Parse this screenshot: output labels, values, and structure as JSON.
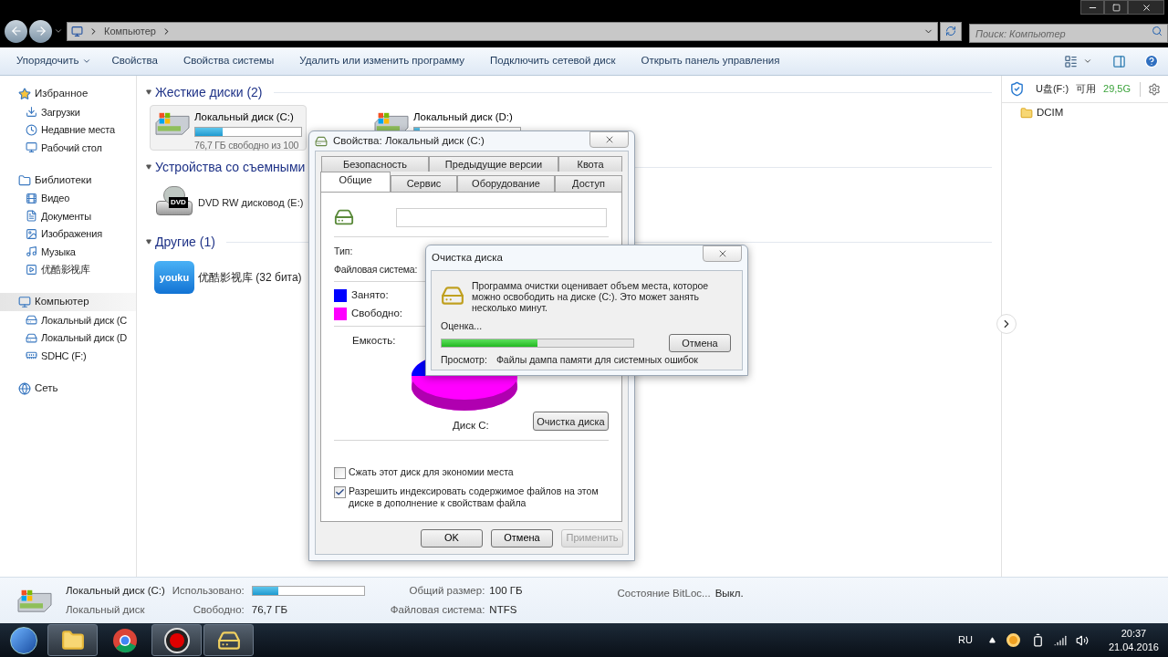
{
  "window": {
    "address": [
      "Компьютер"
    ],
    "search": {
      "placeholder": "Поиск: Компьютер"
    }
  },
  "toolbar": [
    {
      "label": "Упорядочить",
      "kind": "menu"
    },
    {
      "label": "Свойства",
      "kind": "button"
    },
    {
      "label": "Свойства системы",
      "kind": "button"
    },
    {
      "label": "Удалить или изменить программу",
      "kind": "button"
    },
    {
      "label": "Подключить сетевой диск",
      "kind": "button"
    },
    {
      "label": "Открыть панель управления",
      "kind": "button"
    }
  ],
  "sidebar": [
    {
      "label": "Избранное",
      "selected": false,
      "children": [
        {
          "label": "Загрузки",
          "selected": false
        },
        {
          "label": "Недавние места",
          "selected": false
        },
        {
          "label": "Рабочий стол",
          "selected": false
        }
      ]
    },
    {
      "label": "Библиотеки",
      "selected": false,
      "children": [
        {
          "label": "Видео",
          "selected": false
        },
        {
          "label": "Документы",
          "selected": false
        },
        {
          "label": "Изображения",
          "selected": false
        },
        {
          "label": "Музыка",
          "selected": false
        },
        {
          "label": "优酷影视库",
          "selected": false
        }
      ]
    },
    {
      "label": "Компьютер",
      "selected": true,
      "children": [
        {
          "label": "Локальный диск (C",
          "selected": false
        },
        {
          "label": "Локальный диск (D",
          "selected": false
        },
        {
          "label": "SDHC (F:)",
          "selected": false
        }
      ]
    },
    {
      "label": "Сеть",
      "selected": false
    }
  ],
  "groups": [
    {
      "title": "Жесткие диски (2)",
      "items": [
        {
          "kind": "disk",
          "name": "Локальный диск (C:)",
          "level": 0.26,
          "free": "76,7 ГБ свободно из 100",
          "selected": true
        },
        {
          "kind": "disk",
          "name": "Локальный диск (D:)",
          "level": 0.05,
          "selected": false
        }
      ]
    },
    {
      "title": "Устройства со съемными",
      "items": [
        {
          "kind": "dvd",
          "name": "DVD RW дисковод (E:)",
          "logo_text": "DVD",
          "selected": false
        }
      ]
    },
    {
      "title": "Другие (1)",
      "items": [
        {
          "kind": "app",
          "name": "优酷影视库 (32 бита)",
          "logo_text": "youku",
          "selected": false
        }
      ]
    }
  ],
  "right_panel": {
    "drive": "U盘(F:)",
    "available_label": "可用",
    "available": "29,5G",
    "items": [
      "DCIM"
    ]
  },
  "properties_dialog": {
    "title": "Свойства: Локальный диск (C:)",
    "tab_rows": [
      [
        {
          "label": "Безопасность",
          "selected": false
        },
        {
          "label": "Предыдущие версии",
          "selected": false
        },
        {
          "label": "Квота",
          "selected": false
        }
      ],
      [
        {
          "label": "Общие",
          "selected": true
        },
        {
          "label": "Сервис",
          "selected": false
        },
        {
          "label": "Оборудование",
          "selected": false
        },
        {
          "label": "Доступ",
          "selected": false
        }
      ]
    ],
    "type_label": "Тип:",
    "fs_label": "Файловая система:",
    "legend": [
      {
        "label": "Занято:",
        "color": "#0000ff"
      },
      {
        "label": "Свободно:",
        "color": "#ff00ff"
      }
    ],
    "capacity_label": "Емкость:",
    "disk_label": "Диск C:",
    "cleanup_button": "Очистка диска",
    "checkboxes": [
      {
        "label": "Сжать этот диск для экономии места",
        "checked": false
      },
      {
        "label": "Разрешить индексировать содержимое файлов на этом диске в дополнение к свойствам файла",
        "checked": true
      }
    ],
    "buttons": [
      {
        "label": "OK",
        "disabled": false
      },
      {
        "label": "Отмена",
        "disabled": false
      },
      {
        "label": "Применить",
        "disabled": true
      }
    ]
  },
  "cleanup_dialog": {
    "title": "Очистка диска",
    "message": "Программа очистки оценивает объем места, которое можно освободить на диске  (C:). Это может занять несколько минут.",
    "status": "Оценка...",
    "level": 0.5,
    "cancel": "Отмена",
    "scan_label": "Просмотр:",
    "scan_item": "Файлы дампа памяти для системных ошибок"
  },
  "details": {
    "name": "Локальный диск (C:)",
    "type": "Локальный диск",
    "used_label": "Использовано:",
    "level": 0.23,
    "free_label": "Свободно:",
    "free": "76,7 ГБ",
    "total_label": "Общий размер:",
    "total": "100 ГБ",
    "fs_label": "Файловая система:",
    "fs": "NTFS",
    "bitlocker_label": "Состояние BitLoc...",
    "bitlocker": "Выкл."
  },
  "taskbar": {
    "apps": [
      {
        "kind": "explorer",
        "running": true
      },
      {
        "kind": "browser",
        "running": false
      },
      {
        "kind": "recorder",
        "running": true
      },
      {
        "kind": "cleanup",
        "running": true
      }
    ],
    "language": "RU",
    "time": "20:37",
    "date": "21.04.2016"
  }
}
